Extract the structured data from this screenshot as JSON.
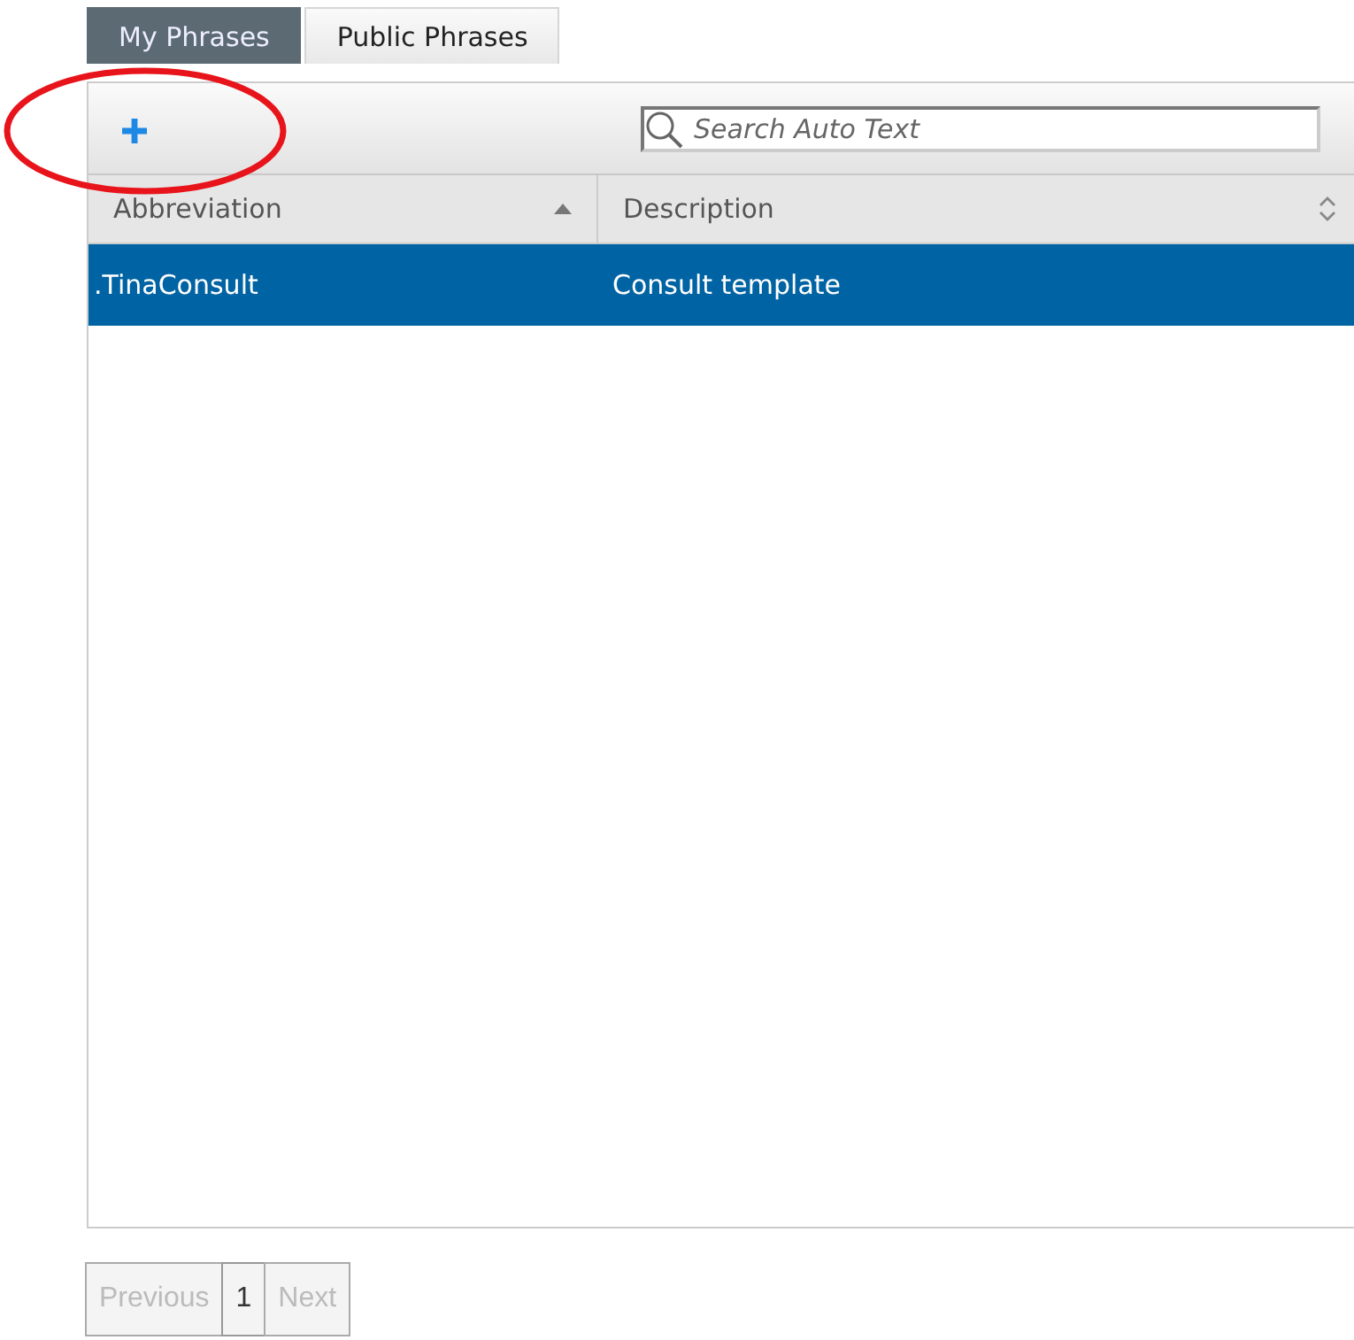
{
  "tabs": [
    {
      "label": "My Phrases",
      "selected": true
    },
    {
      "label": "Public Phrases",
      "selected": false
    }
  ],
  "search": {
    "placeholder": "Search Auto Text"
  },
  "table": {
    "columns": [
      {
        "label": "Abbreviation",
        "sorted": true
      },
      {
        "label": "Description",
        "sorted": false
      }
    ],
    "rows": [
      {
        "cells": [
          ".TinaConsult",
          "Consult template"
        ],
        "selected": true
      }
    ]
  },
  "pager": [
    {
      "label": "Previous",
      "disabled": true
    },
    {
      "label": "1",
      "disabled": false
    },
    {
      "label": "Next",
      "disabled": true
    }
  ],
  "annotation": {
    "kind": "ellipse"
  }
}
